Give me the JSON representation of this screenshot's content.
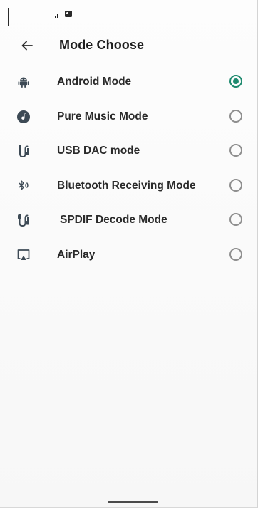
{
  "header": {
    "title": "Mode Choose",
    "back_icon": "arrow-left-icon"
  },
  "status_bar": {
    "icons": [
      "signal-icon",
      "image-icon"
    ]
  },
  "modes": [
    {
      "label": "Android Mode",
      "icon": "android-icon",
      "selected": true
    },
    {
      "label": "Pure Music Mode",
      "icon": "music-disc-icon",
      "selected": false
    },
    {
      "label": "USB DAC mode",
      "icon": "usb-cable-icon",
      "selected": false
    },
    {
      "label": "Bluetooth Receiving Mode",
      "icon": "bluetooth-audio-icon",
      "selected": false
    },
    {
      "label": "SPDIF Decode Mode",
      "icon": "spdif-cable-icon",
      "selected": false
    },
    {
      "label": "AirPlay",
      "icon": "airplay-icon",
      "selected": false
    }
  ],
  "colors": {
    "accent": "#1f8a6f",
    "radio_unchecked": "#8f8f8f",
    "icon": "#3d4a55"
  }
}
